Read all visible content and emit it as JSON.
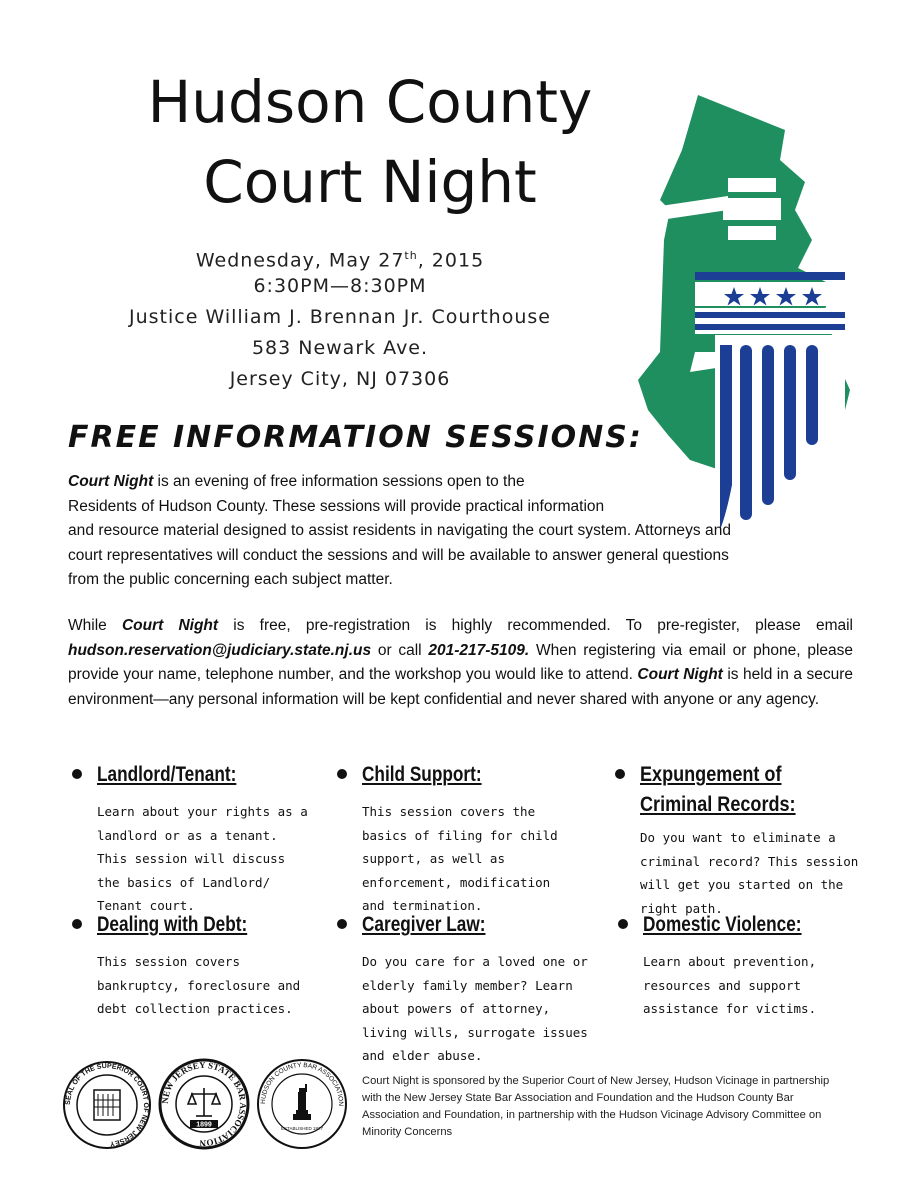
{
  "title": {
    "line1": "Hudson County",
    "line2": "Court Night"
  },
  "event": {
    "date_prefix": "Wednesday, May 27",
    "date_sup": "th",
    "date_suffix": ", 2015",
    "time": "6:30PM—8:30PM",
    "venue": "Justice William J. Brennan Jr. Courthouse",
    "street": "583 Newark Ave.",
    "city": "Jersey City, NJ 07306"
  },
  "headline": "FREE INFORMATION SESSIONS:",
  "intro": {
    "term": "Court Night",
    "line1": " is an evening of free information sessions open to the",
    "line2": "Residents of Hudson County. These sessions will provide practical information",
    "line3": "and resource material designed to assist residents in navigating the court system. Attorneys and",
    "line4": "court representatives will conduct the sessions and will be available to answer general questions",
    "line5": "from the public concerning each subject matter."
  },
  "registration": {
    "t1": "While ",
    "term": "Court Night",
    "t2": " is free, pre-registration is highly recommended. To pre-register, please email ",
    "email": "hudson.reservation@judiciary.state.nj.us",
    "t3": "  or call  ",
    "phone": "201-217-5109.",
    "t4": " When registering via email or phone, please provide your name, telephone number, and the workshop you would like to attend.  ",
    "term2": "Court Night",
    "t5": " is held in a secure environment—any personal information will be kept confidential and never shared with anyone or any agency."
  },
  "topics": [
    {
      "title": "Landlord/Tenant:",
      "desc": "Learn about your rights as a landlord or as a tenant. This session will discuss the basics of Landlord/ Tenant court."
    },
    {
      "title": "Child Support:",
      "desc": "This session covers the basics of filing for child support, as well as enforcement, modification and termination."
    },
    {
      "title": "Expungement of Criminal Records:",
      "desc": "Do you want to eliminate a criminal record? This session will get you started on the right path."
    },
    {
      "title": "Dealing with Debt:",
      "desc": "This session covers bankruptcy, foreclosure and debt collection practices."
    },
    {
      "title": "Caregiver Law:",
      "desc": "Do you care for a loved one or elderly family member? Learn about powers of attorney, living wills, surrogate issues and elder abuse."
    },
    {
      "title": "Domestic Violence:",
      "desc": "Learn about prevention, resources and support assistance for victims."
    }
  ],
  "seals": [
    {
      "text": "SEAL OF THE SUPERIOR COURT OF NEW JERSEY"
    },
    {
      "text": "NEW JERSEY STATE BAR ASSOCIATION",
      "year": "1899"
    },
    {
      "text": "HUDSON COUNTY BAR ASSOCIATION",
      "sub": "ESTABLISHED 1877"
    }
  ],
  "footer": "Court Night is sponsored by the Superior Court of New Jersey, Hudson Vicinage in partnership with the New Jersey State Bar Association and Foundation and the Hudson County Bar Association and Foundation, in partnership with the Hudson Vicinage Advisory Committee on Minority Concerns",
  "colors": {
    "map_green": "#1f8f5f",
    "pillar_blue": "#1c3f95"
  }
}
